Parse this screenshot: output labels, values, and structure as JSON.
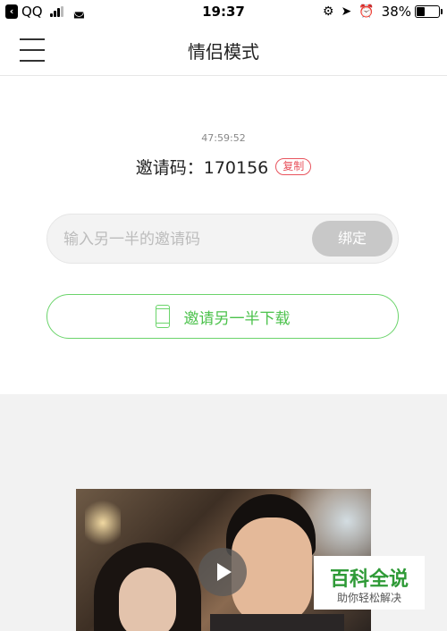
{
  "status_bar": {
    "back_app": "QQ",
    "time": "19:37",
    "battery_percent": "38%",
    "battery_level": 0.38
  },
  "nav": {
    "title": "情侣模式"
  },
  "invite": {
    "countdown": "47:59:52",
    "code_label": "邀请码：",
    "code_value": "170156",
    "copy_label": "复制",
    "input_placeholder": "输入另一半的邀请码",
    "bind_label": "绑定",
    "download_label": "邀请另一半下载"
  },
  "watermark": {
    "title": "百科全说",
    "subtitle": "助你轻松解决"
  },
  "colors": {
    "accent_green": "#4cc24c",
    "copy_red": "#e8535d",
    "watermark_green": "#2e9a36"
  }
}
